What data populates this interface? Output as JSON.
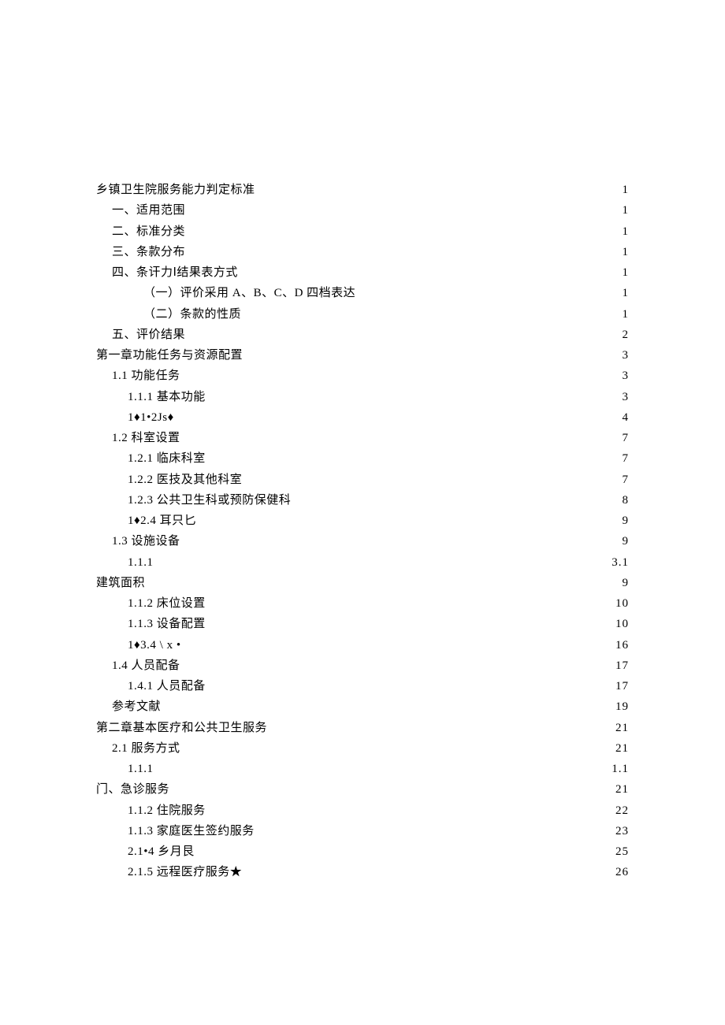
{
  "toc": [
    {
      "indent": 0,
      "leader": "dots",
      "title": "乡镇卫生院服务能力判定标准",
      "page": "1"
    },
    {
      "indent": 1,
      "leader": "dots",
      "title": "一、适用范围",
      "page": "1"
    },
    {
      "indent": 1,
      "leader": "dots",
      "title": "二、标准分类",
      "page": "1"
    },
    {
      "indent": 1,
      "leader": "dots",
      "title": "三、条款分布",
      "page": "1"
    },
    {
      "indent": 1,
      "leader": "stars",
      "title": "四、条讦力Ⅰ结果表方式",
      "page": "1"
    },
    {
      "indent": 3,
      "leader": "dots",
      "title": "（一）评价采用 A、B、C、D 四档表达",
      "page": "1"
    },
    {
      "indent": 3,
      "leader": "dots",
      "title": "（二）条款的性质",
      "page": "1"
    },
    {
      "indent": 1,
      "leader": "dots",
      "title": "五、评价结果",
      "page": "2"
    },
    {
      "indent": 0,
      "leader": "dots",
      "title": "第一章功能任务与资源配置",
      "page": "3"
    },
    {
      "indent": 1,
      "leader": "dots",
      "title": "1.1 功能任务",
      "page": "3"
    },
    {
      "indent": 2,
      "leader": "dots",
      "title": "1.1.1 基本功能",
      "page": "3"
    },
    {
      "indent": 2,
      "leader": "star-dash",
      "title": "1♦1•2Js♦",
      "page": "4"
    },
    {
      "indent": 1,
      "leader": "dots",
      "title": "1.2 科室设置",
      "page": "7"
    },
    {
      "indent": 2,
      "leader": "dots",
      "title": "1.2.1  临床科室",
      "page": "7"
    },
    {
      "indent": 2,
      "leader": "dots",
      "title": "1.2.2 医技及其他科室",
      "page": "7"
    },
    {
      "indent": 2,
      "leader": "dots",
      "title": "1.2.3 公共卫生科或预防保健科",
      "page": "8"
    },
    {
      "indent": 2,
      "leader": "dot-dash",
      "title": "1♦2.4 耳只匕",
      "page": "9"
    },
    {
      "indent": 1,
      "leader": "dots",
      "title": "1.3 设施设备",
      "page": "9"
    },
    {
      "indent": 2,
      "leader": "dots",
      "title": "1.1.1",
      "page": "3.1"
    },
    {
      "indent": 0,
      "leader": "dots",
      "title": "建筑面积",
      "page": "9"
    },
    {
      "indent": 2,
      "leader": "dots",
      "title": "1.1.2  床位设置",
      "page": "10"
    },
    {
      "indent": 2,
      "leader": "dots",
      "title": "1.1.3  设备配置",
      "page": "10"
    },
    {
      "indent": 2,
      "leader": "diamonds",
      "title": "1♦3.4   \\ x •",
      "page": "16"
    },
    {
      "indent": 1,
      "leader": "dots",
      "title": "1.4 人员配备",
      "page": "17"
    },
    {
      "indent": 2,
      "leader": "dots",
      "title": "1.4.1 人员配备",
      "page": "17"
    },
    {
      "indent": 1,
      "leader": "dots",
      "title": "参考文献",
      "page": "19"
    },
    {
      "indent": 0,
      "leader": "dots",
      "title": "第二章基本医疗和公共卫生服务",
      "page": "21"
    },
    {
      "indent": 1,
      "leader": "dots",
      "title": "2.1 服务方式",
      "page": "21"
    },
    {
      "indent": 2,
      "leader": "dots",
      "title": "1.1.1",
      "page": "1.1"
    },
    {
      "indent": 0,
      "leader": "dots",
      "title": "门、急诊服务",
      "page": "21"
    },
    {
      "indent": 2,
      "leader": "dots",
      "title": "1.1.2  住院服务",
      "page": "22"
    },
    {
      "indent": 2,
      "leader": "dots",
      "title": "1.1.3  家庭医生签约服务",
      "page": "23"
    },
    {
      "indent": 2,
      "leader": "diamonds",
      "title": "2.1•4 乡月艮",
      "page": "25"
    },
    {
      "indent": 2,
      "leader": "dots",
      "title": "2.1.5 远程医疗服务★",
      "page": "26"
    }
  ]
}
